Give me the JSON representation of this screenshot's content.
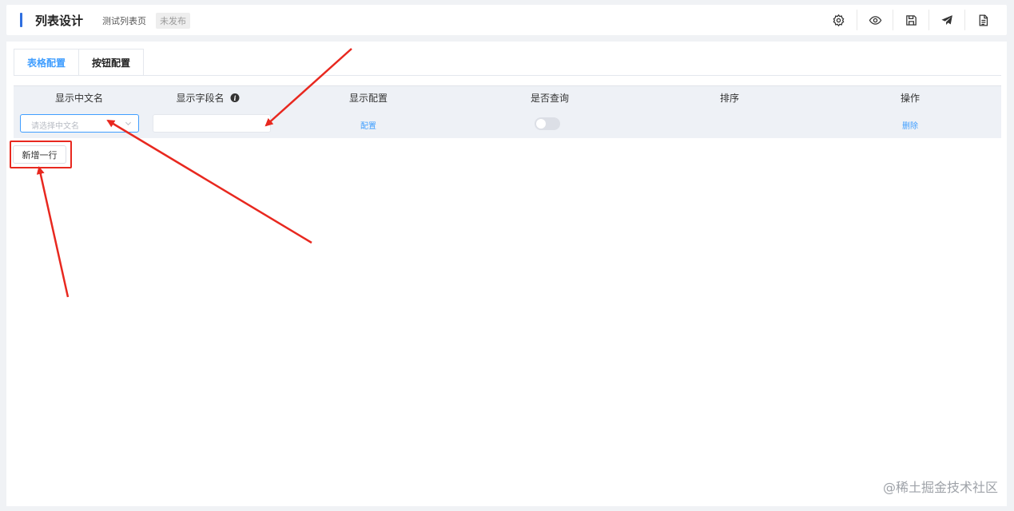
{
  "header": {
    "title": "列表设计",
    "subtitle": "测试列表页",
    "status": "未发布",
    "tools": [
      {
        "icon": "gear-icon"
      },
      {
        "icon": "eye-icon"
      },
      {
        "icon": "save-icon"
      },
      {
        "icon": "send-icon"
      },
      {
        "icon": "document-icon"
      }
    ]
  },
  "tabs": [
    {
      "label": "表格配置",
      "active": true
    },
    {
      "label": "按钮配置",
      "active": false
    }
  ],
  "table": {
    "columns": [
      "显示中文名",
      "显示字段名",
      "显示配置",
      "是否查询",
      "排序",
      "操作"
    ],
    "row": {
      "name_placeholder": "请选择中文名",
      "field_value": "",
      "config_link": "配置",
      "query_enabled": false,
      "delete_link": "删除"
    }
  },
  "add_row_label": "新增一行",
  "watermark": "@稀土掘金技术社区",
  "colors": {
    "accent": "#409eff",
    "annotation": "#e8281f"
  }
}
